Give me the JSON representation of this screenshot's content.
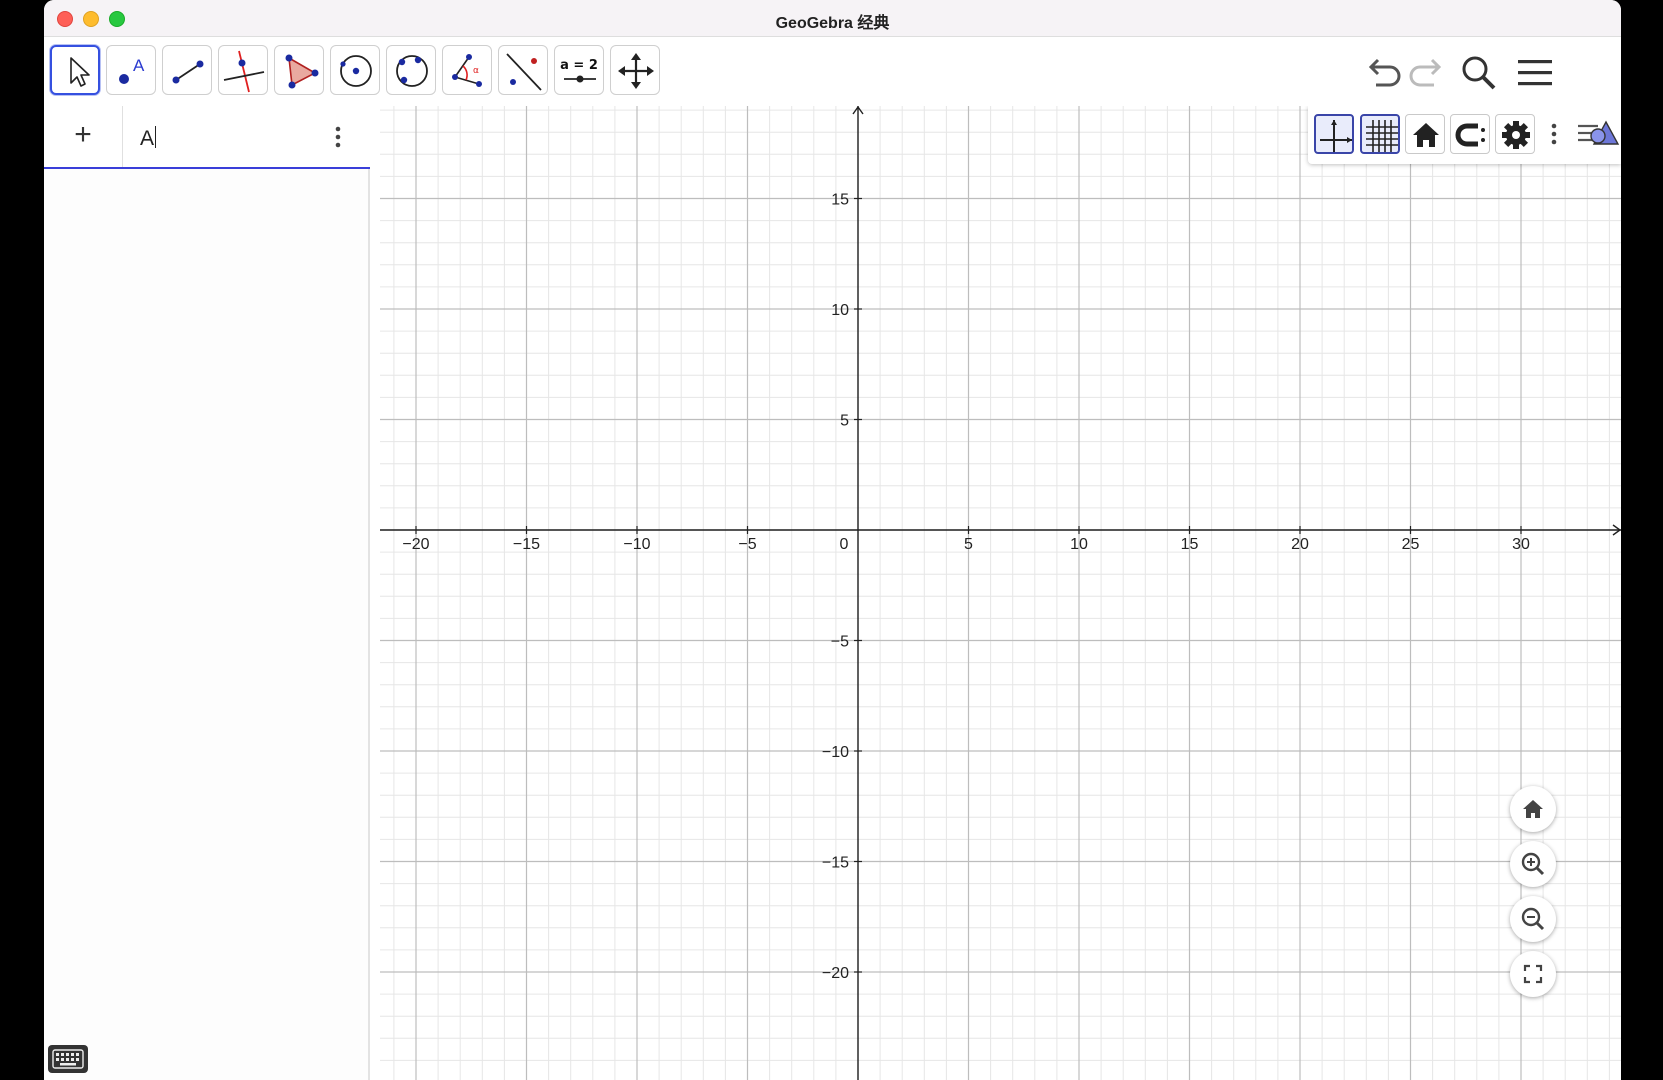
{
  "window": {
    "title": "GeoGebra 经典"
  },
  "toolbar": {
    "tools": [
      {
        "name": "move-tool-icon",
        "label": ""
      },
      {
        "name": "point-tool-icon",
        "label": "A"
      },
      {
        "name": "segment-tool-icon",
        "label": ""
      },
      {
        "name": "perpendicular-line-tool-icon",
        "label": ""
      },
      {
        "name": "polygon-tool-icon",
        "label": ""
      },
      {
        "name": "circle-center-point-tool-icon",
        "label": ""
      },
      {
        "name": "circle-three-points-tool-icon",
        "label": ""
      },
      {
        "name": "angle-tool-icon",
        "label": "α"
      },
      {
        "name": "reflect-line-tool-icon",
        "label": ""
      },
      {
        "name": "slider-tool-icon",
        "label": "a = 2"
      },
      {
        "name": "move-graphics-view-tool-icon",
        "label": ""
      }
    ],
    "selected_tool": "move-tool-icon",
    "right_buttons": [
      "undo-icon",
      "redo-icon",
      "search-icon",
      "menu-icon"
    ]
  },
  "algebra": {
    "plus_label": "+",
    "input_value": "A"
  },
  "graphics": {
    "x_axis_ticks": [
      "−20",
      "−15",
      "−10",
      "−5",
      "0",
      "5",
      "10",
      "15",
      "20",
      "25",
      "30"
    ],
    "y_axis_ticks": [
      "15",
      "10",
      "5",
      "−5",
      "−10",
      "−15",
      "−20"
    ],
    "x_range": [
      -20,
      30
    ],
    "y_range": [
      -20,
      15
    ],
    "major_step": 5,
    "minor_step": 1,
    "grid": true,
    "axes": true,
    "style_bar": [
      "axes-toggle-icon",
      "grid-toggle-icon",
      "standard-view-icon",
      "point-capturing-icon",
      "settings-icon",
      "more-options-icon",
      "graphics-style-icon"
    ],
    "zoom_buttons": [
      "home-icon",
      "zoom-in-icon",
      "zoom-out-icon",
      "fullscreen-icon"
    ]
  }
}
